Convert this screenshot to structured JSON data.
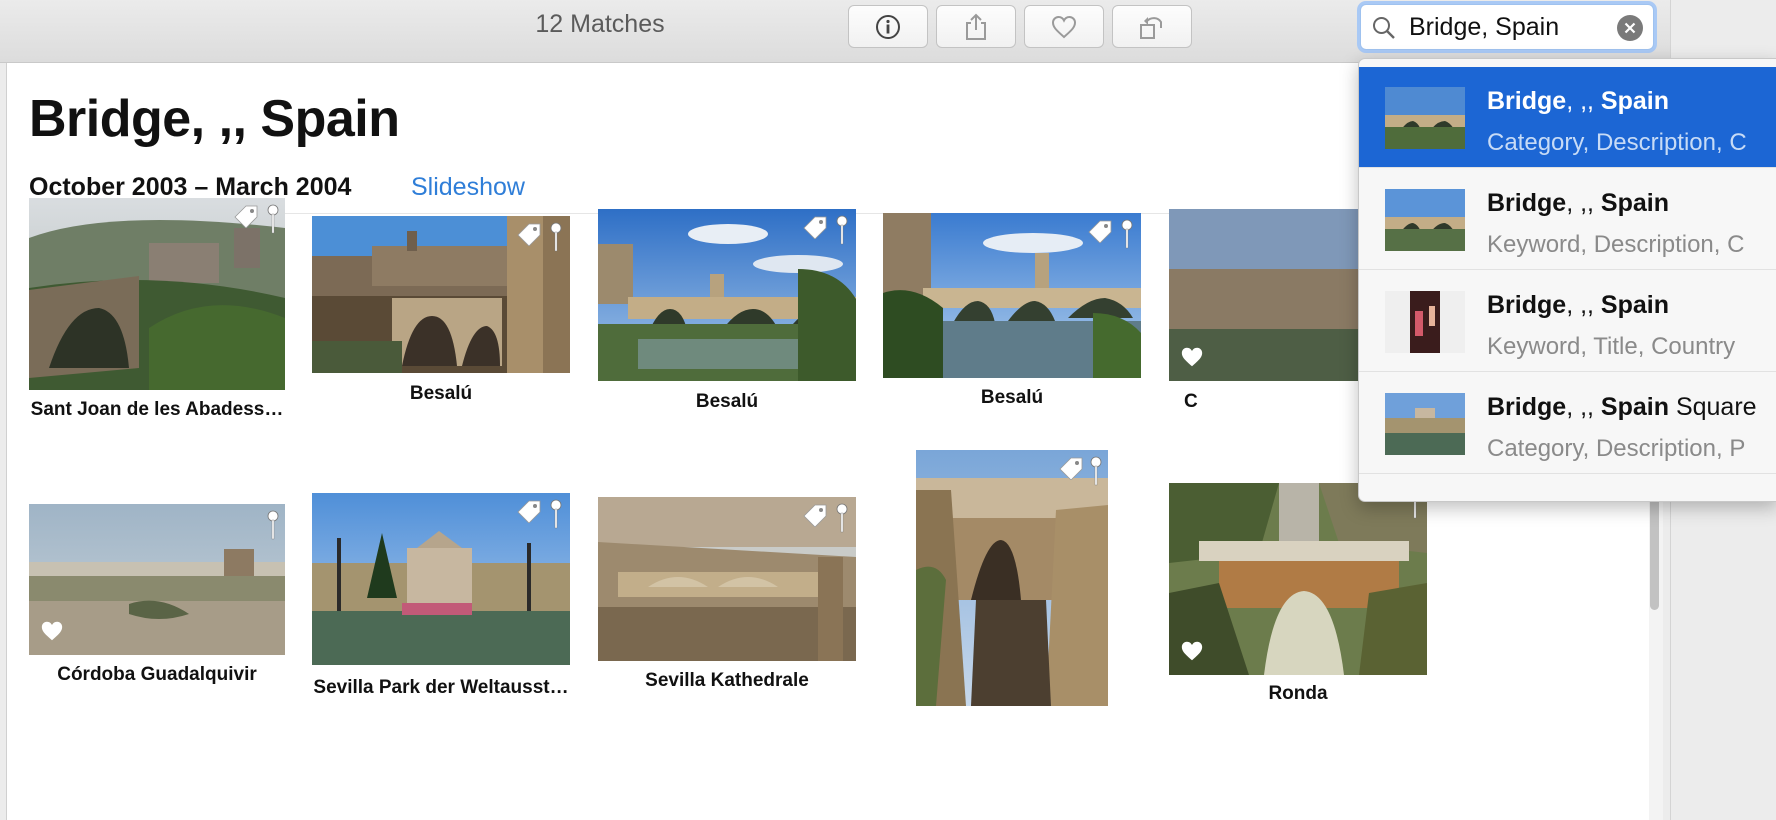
{
  "toolbar": {
    "matches_label": "12 Matches",
    "buttons": [
      {
        "name": "info-icon"
      },
      {
        "name": "share-icon"
      },
      {
        "name": "heart-icon"
      },
      {
        "name": "rotate-icon"
      }
    ]
  },
  "search": {
    "value": "Bridge, Spain",
    "icon": "search-icon",
    "clear_icon": "clear-icon"
  },
  "page": {
    "title": "Bridge, ,, Spain",
    "date_range": "October 2003 – March 2004",
    "slideshow_label": "Slideshow"
  },
  "photos": [
    {
      "caption": "Sant Joan de les Abadess…",
      "tag": true,
      "pin": true,
      "heart": false
    },
    {
      "caption": "Besalú",
      "tag": true,
      "pin": true,
      "heart": false
    },
    {
      "caption": "Besalú",
      "tag": true,
      "pin": true,
      "heart": false
    },
    {
      "caption": "Besalú",
      "tag": true,
      "pin": true,
      "heart": false
    },
    {
      "caption": "C",
      "tag": false,
      "pin": false,
      "heart": true
    },
    {
      "caption": "Córdoba Guadalquivir",
      "tag": false,
      "pin": true,
      "heart": true
    },
    {
      "caption": "Sevilla Park der Weltausst…",
      "tag": true,
      "pin": true,
      "heart": false
    },
    {
      "caption": "Sevilla Kathedrale",
      "tag": true,
      "pin": true,
      "heart": false
    },
    {
      "caption": "",
      "tag": true,
      "pin": true,
      "heart": false
    },
    {
      "caption": "Ronda",
      "tag": false,
      "pin": true,
      "heart": true
    }
  ],
  "suggestions": [
    {
      "bold": "Bridge",
      "mid": ", ,, ",
      "bold2": "Spain",
      "extra": "",
      "sub": "Category, Description, C",
      "selected": true
    },
    {
      "bold": "Bridge",
      "mid": ", ,, ",
      "bold2": "Spain",
      "extra": "",
      "sub": "Keyword, Description, C",
      "selected": false
    },
    {
      "bold": "Bridge",
      "mid": ", ,, ",
      "bold2": "Spain",
      "extra": "",
      "sub": "Keyword, Title, Country",
      "selected": false
    },
    {
      "bold": "Bridge",
      "mid": ", ,, ",
      "bold2": "Spain",
      "extra": " Square",
      "sub": "Category, Description, P",
      "selected": false
    }
  ],
  "colors": {
    "accent": "#1c66d4",
    "link": "#2f7ed8",
    "search_ring": "#a9c9f5"
  }
}
